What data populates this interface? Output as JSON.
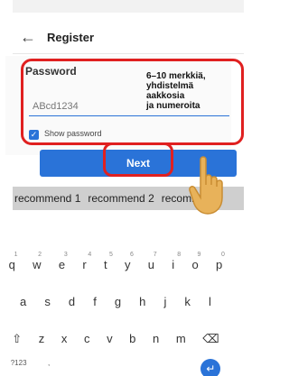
{
  "appbar": {
    "title": "Register",
    "back_icon": "back-arrow-icon"
  },
  "form": {
    "password_label": "Password",
    "password_value": "ABcd1234",
    "show_password_label": "Show password",
    "show_password_checked": true
  },
  "hint": {
    "line1": "6–10 merkkiä,",
    "line2": "yhdistelmä",
    "line3": "aakkosia",
    "line4": "ja numeroita"
  },
  "next_button": {
    "label": "Next"
  },
  "suggestions": [
    "recommend 1",
    "recommend 2",
    "recomm"
  ],
  "keyboard": {
    "row1": [
      {
        "key": "q",
        "num": "1"
      },
      {
        "key": "w",
        "num": "2"
      },
      {
        "key": "e",
        "num": "3"
      },
      {
        "key": "r",
        "num": "4"
      },
      {
        "key": "t",
        "num": "5"
      },
      {
        "key": "y",
        "num": "6"
      },
      {
        "key": "u",
        "num": "7"
      },
      {
        "key": "i",
        "num": "8"
      },
      {
        "key": "o",
        "num": "9"
      },
      {
        "key": "p",
        "num": "0"
      }
    ],
    "row2": [
      "a",
      "s",
      "d",
      "f",
      "g",
      "h",
      "j",
      "k",
      "l"
    ],
    "row3": [
      "z",
      "x",
      "c",
      "v",
      "b",
      "n",
      "m"
    ],
    "symbols_key": "?123",
    "comma_key": ","
  },
  "colors": {
    "accent": "#2a73d8",
    "highlight_red": "#e02020",
    "hand_skin": "#e8b25a"
  }
}
